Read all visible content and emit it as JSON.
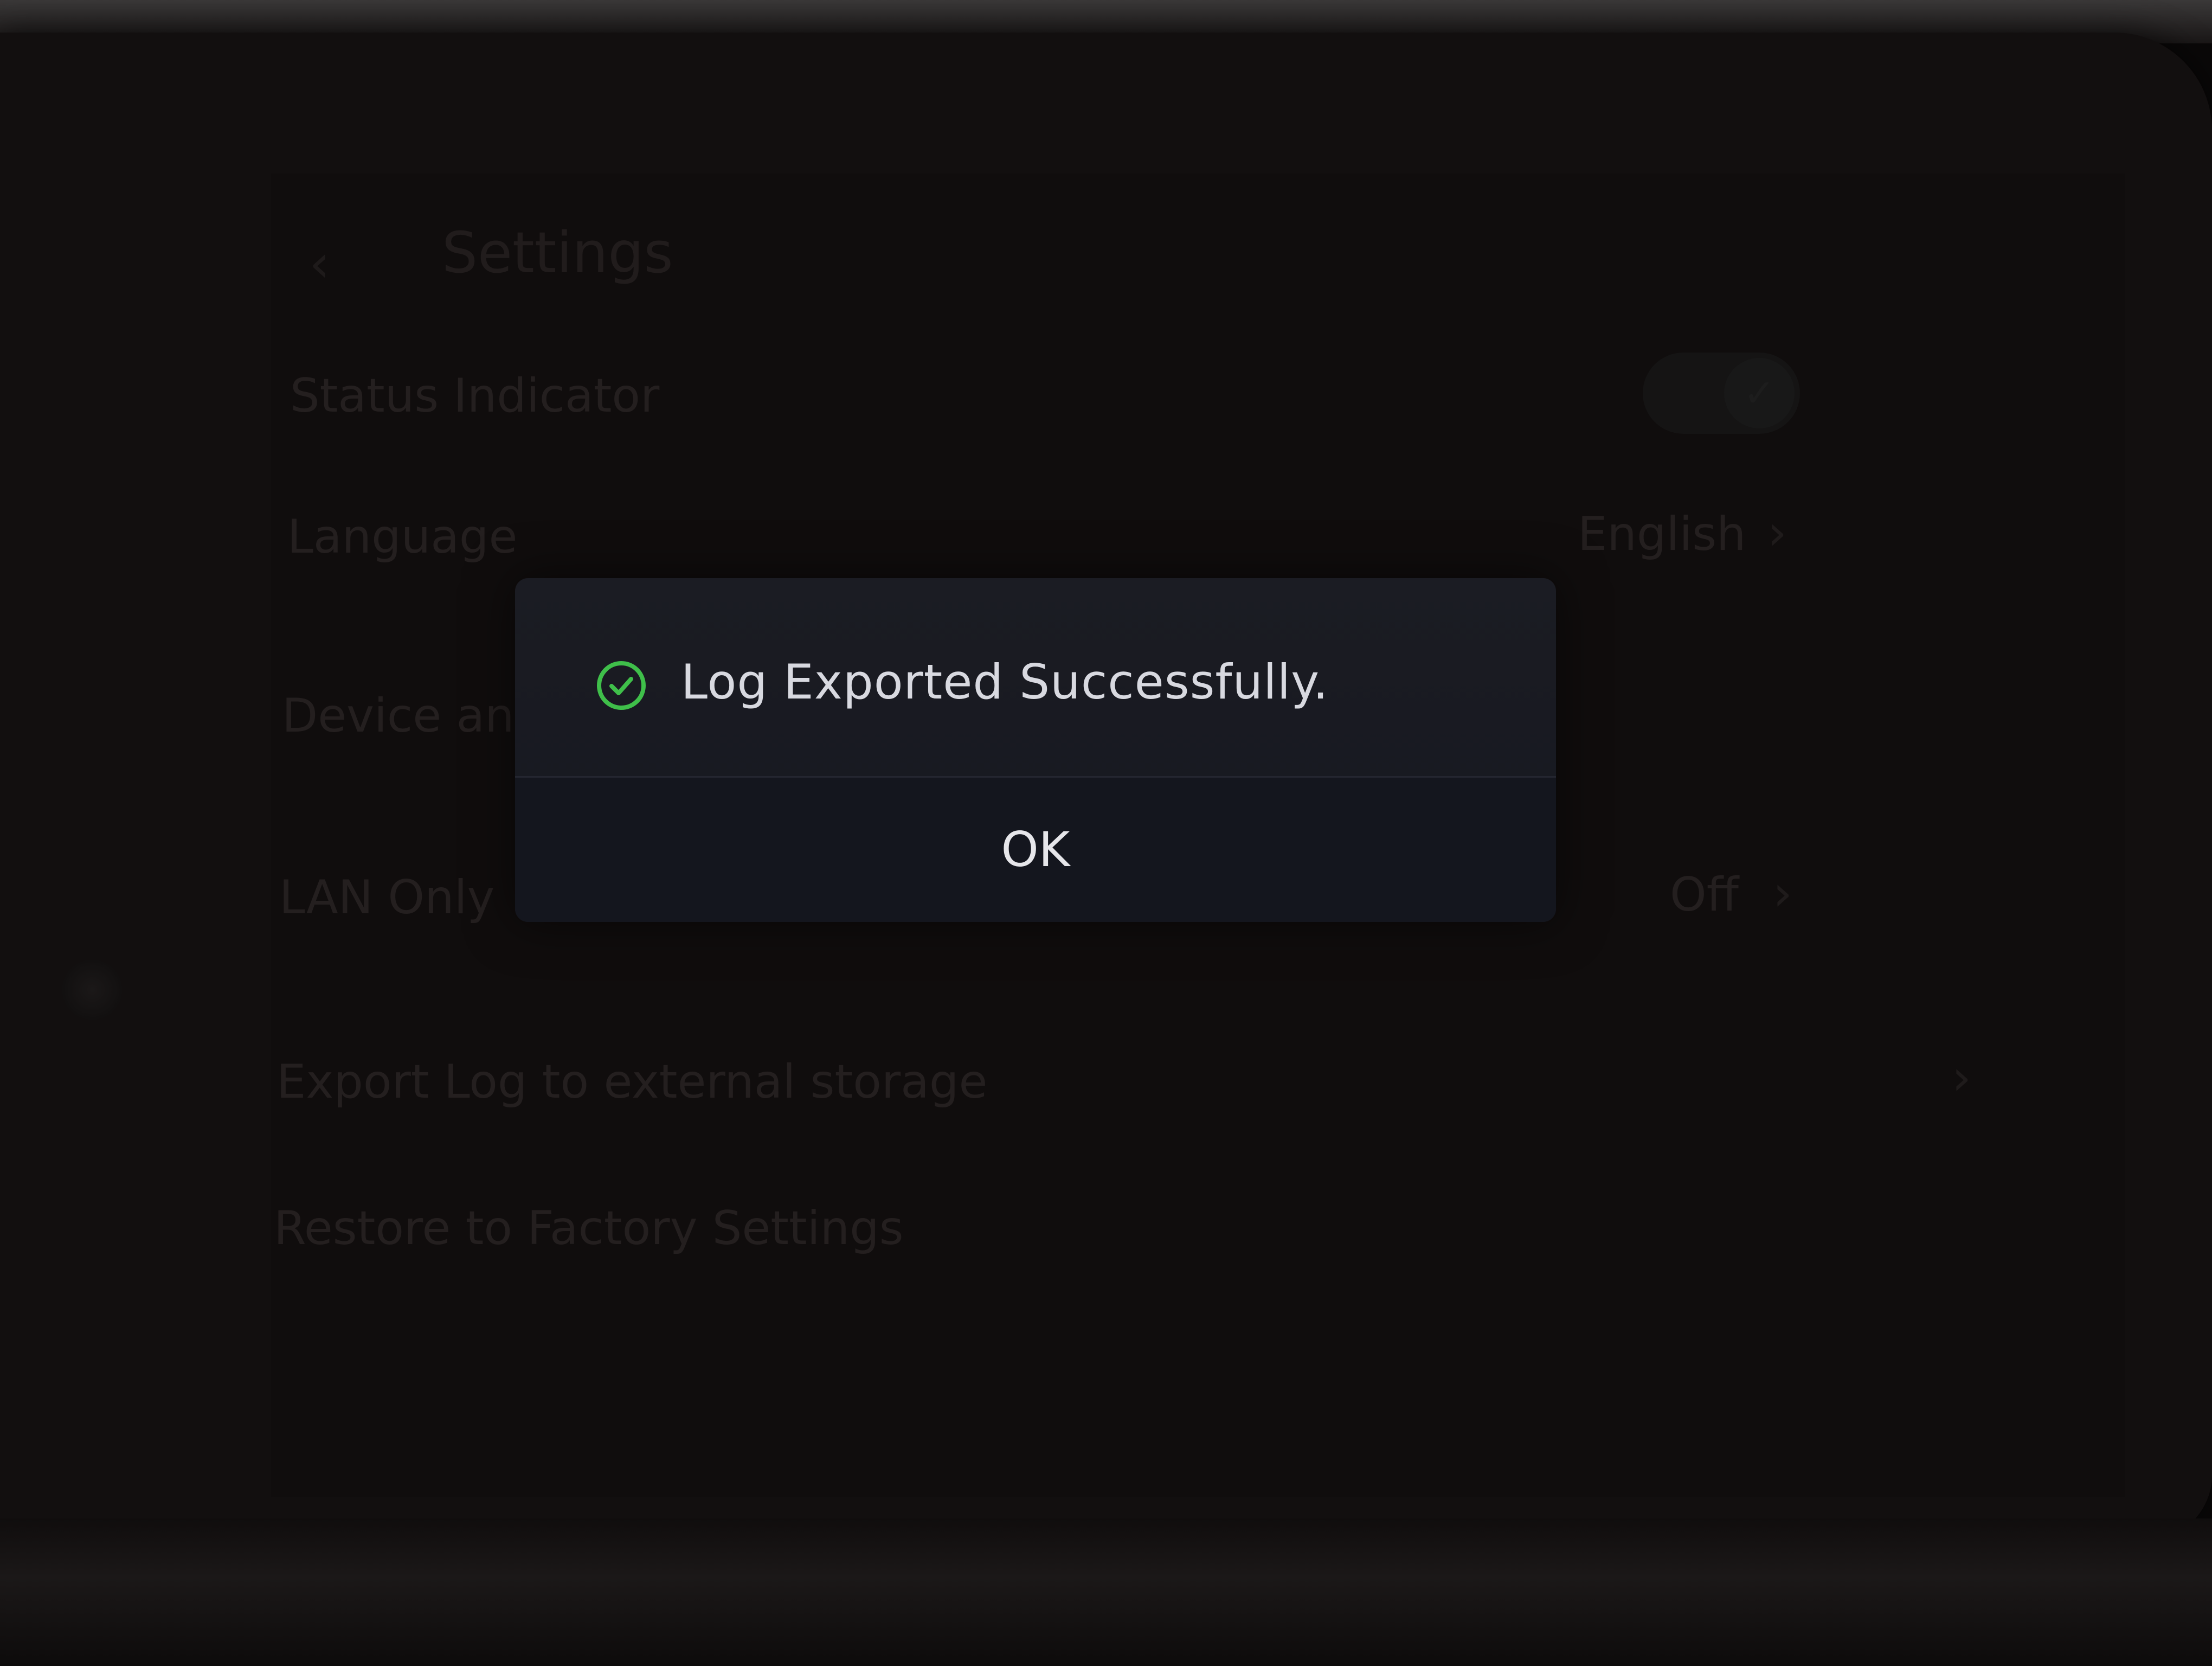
{
  "header": {
    "back_icon": "chevron-left-icon",
    "title": "Settings"
  },
  "settings": {
    "status_indicator": {
      "label": "Status Indicator",
      "toggle_on": true
    },
    "language": {
      "label": "Language",
      "value": "English"
    },
    "device_and": {
      "label": "Device and"
    },
    "lan_only": {
      "label": "LAN Only",
      "value": "Off"
    },
    "export_log": {
      "label": "Export Log to external storage"
    },
    "restore": {
      "label": "Restore to Factory Settings"
    }
  },
  "dialog": {
    "icon": "check-circle-icon",
    "icon_color": "#3fbf4a",
    "message": "Log Exported Successfully.",
    "ok_label": "OK"
  }
}
